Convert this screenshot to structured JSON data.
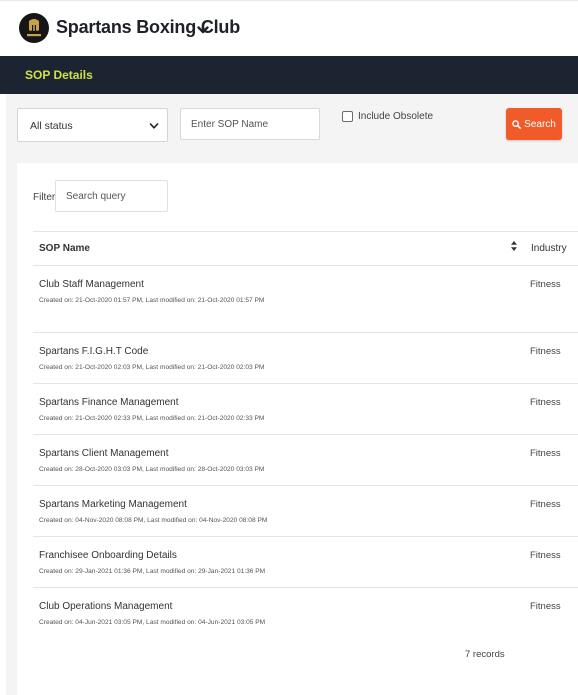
{
  "header": {
    "club_name": "Spartans Boxing Club",
    "logo_icon": "spartan-helmet-logo"
  },
  "banner": {
    "title": "SOP Details",
    "title_color": "#cfe04a",
    "background": "#1c2431"
  },
  "filters": {
    "status_selected": "All status",
    "sop_name_placeholder": "Enter SOP Name",
    "include_obsolete_label": "Include Obsolete",
    "include_obsolete_checked": false,
    "search_button_label": "Search",
    "search_button_color": "#f15a29"
  },
  "table": {
    "filter_label": "Filter:",
    "filter_placeholder": "Search query",
    "columns": [
      "SOP Name",
      "Industry"
    ],
    "rows": [
      {
        "name": "Club Staff Management",
        "meta": "Created on: 21-Oct-2020 01:57 PM, Last modified on: 21-Oct-2020 01:57 PM",
        "industry": "Fitness"
      },
      {
        "name": "Spartans F.I.G.H.T Code",
        "meta": "Created on: 21-Oct-2020 02:03 PM, Last modified on: 21-Oct-2020 02:03 PM",
        "industry": "Fitness"
      },
      {
        "name": "Spartans Finance Management",
        "meta": "Created on: 21-Oct-2020 02:33 PM, Last modified on: 21-Oct-2020 02:33 PM",
        "industry": "Fitness"
      },
      {
        "name": "Spartans Client Management",
        "meta": "Created on: 28-Oct-2020 03:03 PM, Last modified on: 28-Oct-2020 03:03 PM",
        "industry": "Fitness"
      },
      {
        "name": "Spartans Marketing Management",
        "meta": "Created on: 04-Nov-2020 08:08 PM, Last modified on: 04-Nov-2020 08:08 PM",
        "industry": "Fitness"
      },
      {
        "name": "Franchisee Onboarding Details",
        "meta": "Created on: 29-Jan-2021 01:36 PM, Last modified on: 29-Jan-2021 01:36 PM",
        "industry": "Fitness"
      },
      {
        "name": "Club Operations Management",
        "meta": "Created on: 04-Jun-2021 03:05 PM, Last modified on: 04-Jun-2021 03:05 PM",
        "industry": "Fitness"
      }
    ],
    "records_text": "7 records"
  }
}
